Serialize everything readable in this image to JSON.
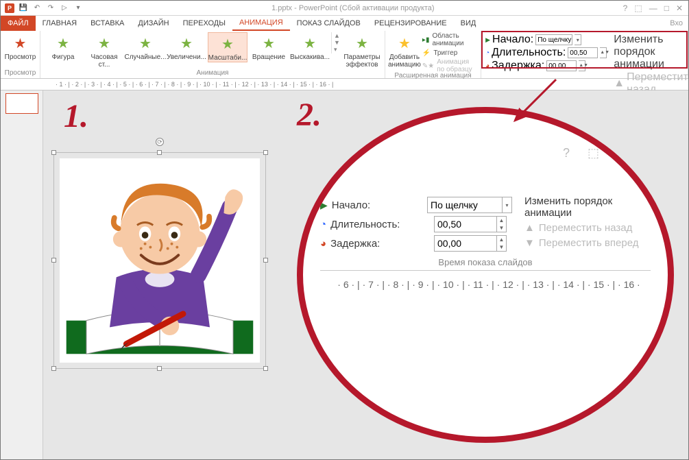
{
  "title": "1.pptx - PowerPoint (Сбой активации продукта)",
  "qat": {
    "save": "💾",
    "undo": "↶",
    "redo": "↷",
    "start": "▷",
    "more": "▾"
  },
  "win": {
    "help": "?",
    "ribbon": "⬚",
    "min": "—",
    "max": "□",
    "close": "✕"
  },
  "tabs": {
    "file": "ФАЙЛ",
    "home": "ГЛАВНАЯ",
    "insert": "ВСТАВКА",
    "design": "ДИЗАЙН",
    "transitions": "ПЕРЕХОДЫ",
    "animation": "АНИМАЦИЯ",
    "slideshow": "ПОКАЗ СЛАЙДОВ",
    "review": "РЕЦЕНЗИРОВАНИЕ",
    "view": "ВИД",
    "login": "Вхо"
  },
  "ribbon": {
    "preview": {
      "label": "Просмотр",
      "group": "Просмотр"
    },
    "effects": {
      "figure": "Фигура",
      "clock": "Часовая ст...",
      "random": "Случайные...",
      "grow": "Увеличени...",
      "zoom": "Масштаби...",
      "spin": "Вращение",
      "bounce": "Выскакива...",
      "group": "Анимация"
    },
    "effect_opts": "Параметры эффектов",
    "add_anim": "Добавить анимацию",
    "adv": {
      "pane": "Область анимации",
      "trigger": "Триггер",
      "painter": "Анимация по образцу",
      "group": "Расширенная анимация"
    },
    "timing": {
      "start_label": "Начало:",
      "start_value": "По щелчку",
      "duration_label": "Длительность:",
      "duration_value": "00,50",
      "delay_label": "Задержка:",
      "delay_value": "00,00",
      "reorder_title": "Изменить порядок анимации",
      "move_back": "Переместить назад",
      "move_fwd": "Переместить вперед",
      "group": "Время показа слайдов"
    }
  },
  "ruler_top": "· 1 · | · 2 · | · 3 · | · 4 · | · 5 · | · 6 · | · 7 · | · 8 · | · 9 · | · 10 · | · 11 · | · 12 · | · 13 · | · 14 · | · 15 · | · 16 · |",
  "annotations": {
    "one": "1.",
    "two": "2."
  },
  "zoom": {
    "start_label": "Начало:",
    "start_value": "По щелчку",
    "duration_label": "Длительность:",
    "duration_value": "00,50",
    "delay_label": "Задержка:",
    "delay_value": "00,00",
    "reorder_title": "Изменить порядок анимации",
    "move_back": "Переместить назад",
    "move_fwd": "Переместить вперед",
    "group": "Время показа слайдов",
    "ruler": "· 6 · | · 7 · | · 8 · | · 9 · | · 10 · | · 11 · | · 12 · | · 13 · | · 14 · | · 15 · | · 16 ·"
  }
}
